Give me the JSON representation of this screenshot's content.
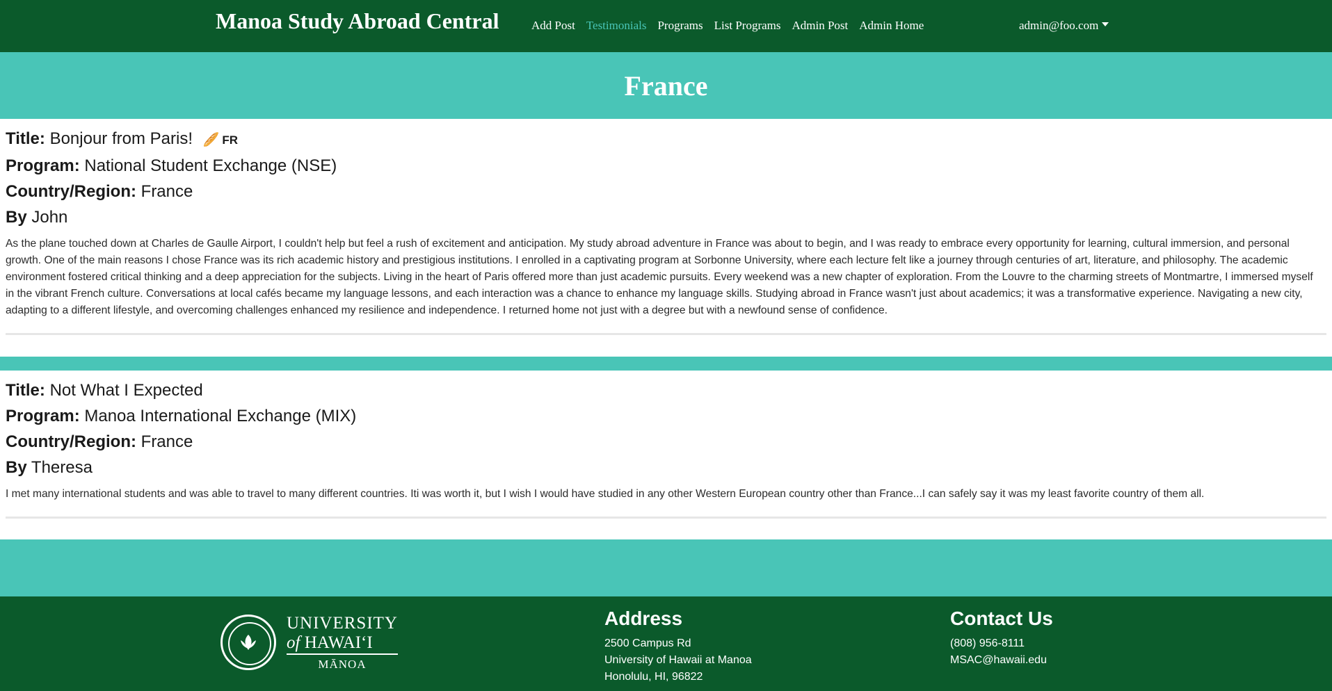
{
  "navbar": {
    "brand": "Manoa Study Abroad Central",
    "links": [
      {
        "label": "Add Post"
      },
      {
        "label": "Testimonials"
      },
      {
        "label": "Programs"
      },
      {
        "label": "List Programs"
      },
      {
        "label": "Admin Post"
      },
      {
        "label": "Admin Home"
      }
    ],
    "active_link": "Testimonials",
    "user": "admin@foo.com"
  },
  "hero": {
    "title": "France"
  },
  "labels": {
    "title": "Title:",
    "program": "Program:",
    "country": "Country/Region:",
    "by": "By"
  },
  "posts": [
    {
      "title": "Bonjour from Paris!",
      "flag_icon": "baguette-icon",
      "flag_code": "FR",
      "program": "National Student Exchange (NSE)",
      "country": "France",
      "author": "John",
      "body": "As the plane touched down at Charles de Gaulle Airport, I couldn't help but feel a rush of excitement and anticipation. My study abroad adventure in France was about to begin, and I was ready to embrace every opportunity for learning, cultural immersion, and personal growth. One of the main reasons I chose France was its rich academic history and prestigious institutions. I enrolled in a captivating program at Sorbonne University, where each lecture felt like a journey through centuries of art, literature, and philosophy. The academic environment fostered critical thinking and a deep appreciation for the subjects. Living in the heart of Paris offered more than just academic pursuits. Every weekend was a new chapter of exploration. From the Louvre to the charming streets of Montmartre, I immersed myself in the vibrant French culture. Conversations at local cafés became my language lessons, and each interaction was a chance to enhance my language skills. Studying abroad in France wasn't just about academics; it was a transformative experience. Navigating a new city, adapting to a different lifestyle, and overcoming challenges enhanced my resilience and independence. I returned home not just with a degree but with a newfound sense of confidence."
    },
    {
      "title": "Not What I Expected",
      "program": "Manoa International Exchange (MIX)",
      "country": "France",
      "author": "Theresa",
      "body": "I met many international students and was able to travel to many different countries. Iti was worth it, but I wish I would have studied in any other Western European country other than France...I can safely say it was my least favorite country of them all."
    }
  ],
  "footer": {
    "logo": {
      "line1": "UNIVERSITY",
      "line2_of": "of",
      "line2_name": "HAWAI‘I",
      "line3": "MĀNOA"
    },
    "address": {
      "heading": "Address",
      "line1": "2500 Campus Rd",
      "line2": "University of Hawaii at Manoa",
      "line3": "Honolulu, HI, 96822"
    },
    "contact": {
      "heading": "Contact Us",
      "phone": "(808) 956-8111",
      "email": "MSAC@hawaii.edu"
    }
  },
  "colors": {
    "dark_green": "#0b5a2b",
    "teal": "#49c5b7"
  }
}
